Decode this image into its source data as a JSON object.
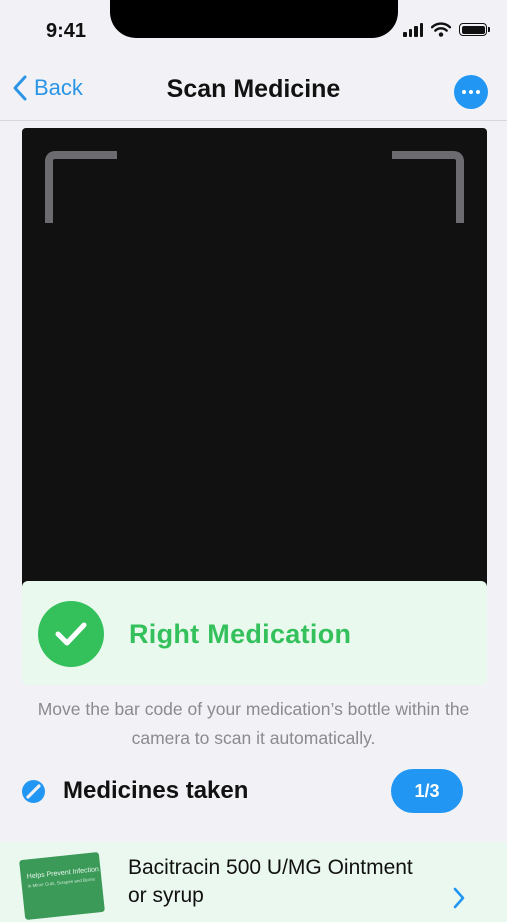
{
  "status_bar": {
    "time": "9:41"
  },
  "nav": {
    "back_label": "Back",
    "title": "Scan Medicine"
  },
  "result": {
    "text": "Right Medication",
    "status_color": "#34c15c"
  },
  "instruction": "Move the bar code of your medication’s bottle within the camera to scan it automatically.",
  "medicines_taken": {
    "label": "Medicines taken",
    "count": "1/3"
  },
  "medication": {
    "name": "Bacitracin 500 U/MG Ointment or syrup",
    "package_text": "Helps Prevent Infection",
    "package_subtext": "in Minor Cuts, Scrapes and Burns"
  },
  "colors": {
    "accent": "#2196f3",
    "success": "#34c15c",
    "camera": "#111111"
  }
}
